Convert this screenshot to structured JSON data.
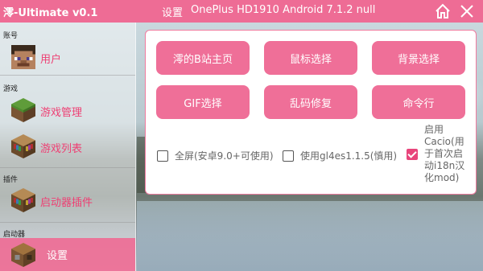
{
  "topbar": {
    "app_title": "澪-Ultimate v0.1",
    "screen_title": "设置",
    "device_info": "OnePlus HD1910 Android 7.1.2 null"
  },
  "sidebar": {
    "sections": {
      "account": "账号",
      "game": "游戏",
      "plugin": "插件",
      "launcher": "启动器"
    },
    "items": [
      {
        "label": "用户",
        "icon": "steve-head-icon"
      },
      {
        "label": "游戏管理",
        "icon": "grass-block-icon"
      },
      {
        "label": "游戏列表",
        "icon": "bookshelf-icon"
      },
      {
        "label": "启动器插件",
        "icon": "bookshelf-icon"
      },
      {
        "label": "设置",
        "icon": "crafting-table-icon"
      }
    ]
  },
  "settings": {
    "buttons": [
      "澪的B站主页",
      "鼠标选择",
      "背景选择",
      "GIF选择",
      "乱码修复",
      "命令行"
    ],
    "checkboxes": [
      {
        "label": "全屏(安卓9.0+可使用)",
        "checked": false
      },
      {
        "label": "使用gl4es1.1.5(慎用)",
        "checked": false
      },
      {
        "label": "启用Cacio(用于首次启动i18n汉化mod)",
        "checked": true
      }
    ]
  },
  "colors": {
    "accent": "#ee6c95",
    "button": "#ef6f98"
  }
}
